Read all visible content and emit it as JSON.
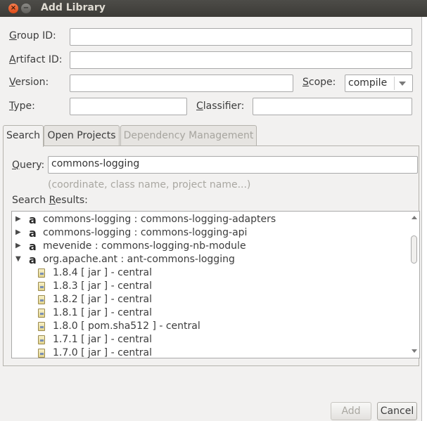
{
  "window": {
    "title": "Add Library",
    "close_glyph": "×",
    "minimize_glyph": "−"
  },
  "form": {
    "group_id": {
      "mnemonic": "G",
      "rest": "roup ID:",
      "value": ""
    },
    "artifact_id": {
      "mnemonic": "A",
      "rest": "rtifact ID:",
      "value": ""
    },
    "version": {
      "mnemonic": "V",
      "rest": "ersion:",
      "value": ""
    },
    "scope": {
      "mnemonic": "S",
      "rest": "cope:",
      "value": "compile"
    },
    "type": {
      "mnemonic": "T",
      "rest": "ype:",
      "value": ""
    },
    "classifier": {
      "mnemonic": "C",
      "rest": "lassifier:",
      "value": ""
    }
  },
  "tabs": [
    {
      "label": "Search",
      "state": "active"
    },
    {
      "label": "Open Projects",
      "state": "normal"
    },
    {
      "label": "Dependency Management",
      "state": "disabled"
    }
  ],
  "search": {
    "query_mnemonic": "Q",
    "query_rest": "uery:",
    "query_value": "commons-logging",
    "hint": "(coordinate, class name, project name...)",
    "results_prefix": "Search ",
    "results_mnemonic": "R",
    "results_rest": "esults:"
  },
  "results": {
    "artifacts": [
      {
        "expander": "▶",
        "kind": "a",
        "coord": "commons-logging : commons-logging-adapters"
      },
      {
        "expander": "▶",
        "kind": "a",
        "coord": "commons-logging : commons-logging-api"
      },
      {
        "expander": "▶",
        "kind": "a",
        "coord": "mevenide : commons-logging-nb-module"
      },
      {
        "expander": "▼",
        "kind": "a",
        "coord": "org.apache.ant : ant-commons-logging"
      }
    ],
    "versions": [
      {
        "label": "1.8.4 [ jar ] - central",
        "icon": "jar-icon"
      },
      {
        "label": "1.8.3 [ jar ] - central",
        "icon": "jar-icon"
      },
      {
        "label": "1.8.2 [ jar ] - central",
        "icon": "jar-icon"
      },
      {
        "label": "1.8.1 [ jar ] - central",
        "icon": "jar-icon"
      },
      {
        "label": "1.8.0 [ pom.sha512 ] - central",
        "icon": "jar-icon"
      },
      {
        "label": "1.7.1 [ jar ] - central",
        "icon": "jar-icon"
      },
      {
        "label": "1.7.0 [ jar ] - central",
        "icon": "jar-icon"
      }
    ]
  },
  "buttons": {
    "add": "Add",
    "cancel": "Cancel"
  }
}
